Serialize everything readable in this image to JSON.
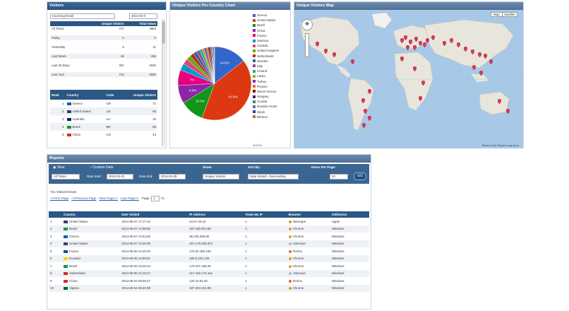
{
  "visitors": {
    "title": "Visitors",
    "period_select": "Incoming Email",
    "date_range": "2014-03-0",
    "stats_headers": [
      "",
      "Unique Visitors",
      "Total Views"
    ],
    "stats": [
      [
        "All Times",
        "727",
        "4984"
      ],
      [
        "Today",
        "0",
        "0"
      ],
      [
        "Yesterday",
        "5",
        "11"
      ],
      [
        "Last Week",
        "36",
        "466"
      ],
      [
        "Last 30 Days",
        "367",
        "1920"
      ],
      [
        "Last Year",
        "722",
        "4950"
      ]
    ],
    "country_headers": [
      "Rank",
      "Country",
      "Code",
      "Unique Visitors"
    ],
    "countries": [
      [
        "1",
        "Greece",
        "GR",
        "71"
      ],
      [
        "2",
        "United States",
        "US",
        "60"
      ],
      [
        "3",
        "Australia",
        "AU",
        "15"
      ],
      [
        "4",
        "Brazil",
        "BR",
        "56"
      ],
      [
        "5",
        "China",
        "CN",
        "44"
      ]
    ]
  },
  "chart_panel": {
    "title": "Unique Visitors Per Country Chart",
    "legend_more": "1/4"
  },
  "chart_data": {
    "type": "pie",
    "labels": [
      "Greece",
      "United States",
      "Brazil",
      "China",
      "France",
      "Jamaica",
      "Canada",
      "United Kingdom",
      "Netherlands",
      "Sweden",
      "Italy",
      "Iceland",
      "Latvia",
      "Turkey",
      "Proxies",
      "Mount Vernon",
      "Hungary",
      "Croatia",
      "Russian Feder.",
      "Spain",
      "Belarus"
    ],
    "values": [
      14.6,
      41.6,
      10.6,
      8.0,
      7.0,
      3.0,
      2.5,
      2.0,
      1.8,
      1.6,
      1.4,
      1.2,
      1.0,
      0.9,
      0.8,
      0.7,
      0.6,
      0.5,
      0.5,
      0.4,
      0.3
    ],
    "slice_labels": [
      "14.6%",
      "41.6%",
      "10.6%",
      "8.0%",
      "7%"
    ],
    "colors": [
      "#3366cc",
      "#dc3912",
      "#109618",
      "#8e24aa",
      "#e6007e",
      "#0099c6",
      "#dd4477",
      "#66aa00",
      "#b82e2e",
      "#316395",
      "#994499",
      "#22aa99",
      "#aaaa11",
      "#6633cc",
      "#e67300",
      "#8b0707",
      "#651067",
      "#329262",
      "#5574a6",
      "#3b3eac",
      "#b77322"
    ]
  },
  "map_panel": {
    "title": "Unique Visitors Map",
    "map_btn": "Map",
    "sat_btn": "Satellite",
    "attribution": "Terms of Use  Report a map error"
  },
  "reports": {
    "title": "Reports",
    "radio_view": "View",
    "radio_custom": "Custom Date",
    "period": "All Times",
    "date_start_label": "Date Start:",
    "date_start": "2014-04-01",
    "date_end_label": "Date End:",
    "date_end": "2014-04-29",
    "show_label": "Show:",
    "show_value": "Unique Visitors",
    "sort_label": "Sort By:",
    "sort_value": "Date Visited - Descending",
    "rows_label": "Rows Per Page:",
    "rows_value": "10",
    "go": "GO",
    "summary": "721 Visitors/Views",
    "pager": {
      "first": "<<First Page",
      "prev": "<<Previous Page",
      "next": "Next Page>>",
      "last": "Last Page>>",
      "page_label": "Page:",
      "page": "1",
      "of": "73"
    },
    "headers": [
      "",
      "Country",
      "Date Visited",
      "IP Address",
      "Views By IP",
      "Browser",
      "OS/Device"
    ],
    "rows": [
      [
        "1",
        "United States",
        "2014-05-07 17:17:10",
        "54.67.40.19",
        "1",
        "Netscape",
        "Apple"
      ],
      [
        "2",
        "Brazil",
        "2014-05-07 14:58:50",
        "187.180.89.249",
        "4",
        "Chrome",
        "Windows"
      ],
      [
        "3",
        "Greece",
        "2014-05-07 13:54:29",
        "85.235.255.80",
        "1",
        "Chrome",
        "Windows"
      ],
      [
        "4",
        "United States",
        "2014-05-07 13:25:09",
        "157.170.205.201",
        "1",
        "Unknown",
        "Windows"
      ],
      [
        "5",
        "France",
        "2014-05-06 14:25:04",
        "176.32.160.190",
        "1",
        "Firefox",
        "Windows"
      ],
      [
        "6",
        "Ecuador",
        "2014-05-06 13:59:51",
        "186.5.222.130",
        "1",
        "Chrome",
        "Windows"
      ],
      [
        "7",
        "Brazil",
        "2014-05-06 13:26:24",
        "179.187.189.28",
        "1",
        "Chrome",
        "Windows"
      ],
      [
        "8",
        "Switzerland",
        "2014-05-06 12:10:17",
        "217.192.174.161",
        "1",
        "Unknown",
        "Windows"
      ],
      [
        "9",
        "China",
        "2014-05-04 09:56:27",
        "120.10.91.60",
        "1",
        "Firefox",
        "Windows"
      ],
      [
        "10",
        "Algeria",
        "2014-05-04 06:40:08",
        "197.204.221.95",
        "1",
        "Chrome",
        "Windows"
      ]
    ],
    "flag_colors": [
      "#3c3b6e",
      "#009c3b",
      "#0d5eaf",
      "#3c3b6e",
      "#0055a4",
      "#ffd100",
      "#009c3b",
      "#d52b1e",
      "#de2910",
      "#006233"
    ],
    "browser_colors": [
      "#c79a3a",
      "#e0a020",
      "#e0a020",
      "#b8b8b8",
      "#e86a1a",
      "#e0a020",
      "#e0a020",
      "#b8b8b8",
      "#e86a1a",
      "#e0a020"
    ]
  }
}
